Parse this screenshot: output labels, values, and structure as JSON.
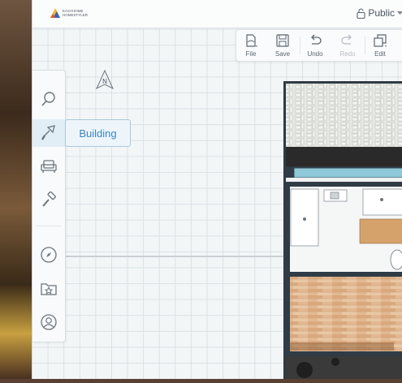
{
  "app": {
    "logo_text_line1": "EASYHOME",
    "logo_text_line2": "HOMESTYLER",
    "visibility_label": "Public"
  },
  "toolbar": {
    "items": [
      {
        "label": "File",
        "icon": "file-icon",
        "enabled": true
      },
      {
        "label": "Save",
        "icon": "save-icon",
        "enabled": true
      },
      {
        "label": "Undo",
        "icon": "undo-icon",
        "enabled": true
      },
      {
        "label": "Redo",
        "icon": "redo-icon",
        "enabled": false
      },
      {
        "label": "Edit",
        "icon": "edit-icon",
        "enabled": true
      }
    ]
  },
  "sidebar": {
    "items": [
      {
        "name": "search",
        "icon": "search-icon"
      },
      {
        "name": "building",
        "icon": "trowel-icon",
        "active": true
      },
      {
        "name": "furniture",
        "icon": "armchair-icon"
      },
      {
        "name": "paint",
        "icon": "paint-roller-icon"
      },
      {
        "name": "inspiration",
        "icon": "compass-icon"
      },
      {
        "name": "favorites",
        "icon": "star-folder-icon"
      },
      {
        "name": "account",
        "icon": "user-icon"
      }
    ],
    "tooltip": "Building"
  },
  "canvas": {
    "compass_label": "N"
  },
  "colors": {
    "accent": "#3a86c0",
    "grid": "#d9e1e6",
    "wall": "#2f3b45"
  }
}
